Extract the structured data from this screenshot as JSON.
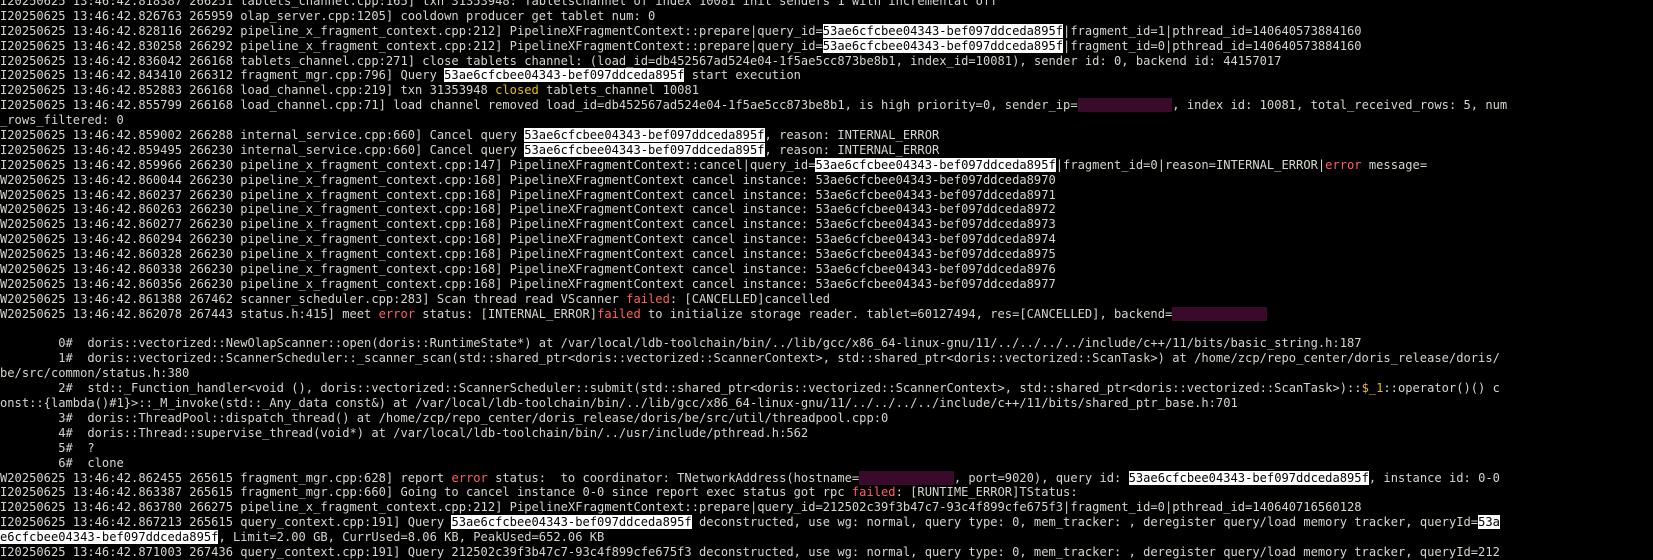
{
  "terminal": {
    "lines": [
      [
        {
          "t": "I20250625 13:46:42.818387 266251 tablets_channel.cpp:165] txn 31353948: TabletsChannel of index 10081 init senders 1 with incremental off"
        }
      ],
      [
        {
          "t": "I20250625 13:46:42.826763 265959 olap_server.cpp:1205] cooldown producer get tablet num: 0"
        }
      ],
      [
        {
          "t": "I20250625 13:46:42.828116 266292 pipeline_x_fragment_context.cpp:212] PipelineXFragmentContext::prepare|query_id="
        },
        {
          "t": "53ae6cfcbee04343-bef097ddceda895f",
          "c": "hl"
        },
        {
          "t": "|fragment_id=1|pthread_id=140640573884160"
        }
      ],
      [
        {
          "t": "I20250625 13:46:42.830258 266292 pipeline_x_fragment_context.cpp:212] PipelineXFragmentContext::prepare|query_id="
        },
        {
          "t": "53ae6cfcbee04343-bef097ddceda895f",
          "c": "hl"
        },
        {
          "t": "|fragment_id=0|pthread_id=140640573884160"
        }
      ],
      [
        {
          "t": "I20250625 13:46:42.836042 266168 tablets_channel.cpp:271] close tablets channel: (load_id=db452567ad524e04-1f5ae5cc873be8b1, index_id=10081), sender id: 0, backend id: 44157017"
        }
      ],
      [
        {
          "t": "I20250625 13:46:42.843410 266312 fragment_mgr.cpp:796] Query "
        },
        {
          "t": "53ae6cfcbee04343-bef097ddceda895f",
          "c": "hl"
        },
        {
          "t": " start execution"
        }
      ],
      [
        {
          "t": "I20250625 13:46:42.852883 266168 load_channel.cpp:219] txn 31353948 "
        },
        {
          "t": "closed",
          "c": "kwy"
        },
        {
          "t": " tablets_channel 10081"
        }
      ],
      [
        {
          "t": "I20250625 13:46:42.855799 266168 load_channel.cpp:71] load channel removed load_id=db452567ad524e04-1f5ae5cc873be8b1, is high priority=0, sender_ip="
        },
        {
          "t": "             ",
          "c": "red"
        },
        {
          "t": ", index id: 10081, total_received_rows: 5, num"
        }
      ],
      [
        {
          "t": "_rows_filtered: 0"
        }
      ],
      [
        {
          "t": "I20250625 13:46:42.859002 266288 internal_service.cpp:660] Cancel query "
        },
        {
          "t": "53ae6cfcbee04343-bef097ddceda895f",
          "c": "hl"
        },
        {
          "t": ", reason: INTERNAL_ERROR"
        }
      ],
      [
        {
          "t": "I20250625 13:46:42.859495 266230 internal_service.cpp:660] Cancel query "
        },
        {
          "t": "53ae6cfcbee04343-bef097ddceda895f",
          "c": "hl"
        },
        {
          "t": ", reason: INTERNAL_ERROR"
        }
      ],
      [
        {
          "t": "I20250625 13:46:42.859966 266230 pipeline_x_fragment_context.cpp:147] PipelineXFragmentContext::cancel|query_id="
        },
        {
          "t": "53ae6cfcbee04343-bef097ddceda895f",
          "c": "hl"
        },
        {
          "t": "|fragment_id=0|reason=INTERNAL_ERROR|"
        },
        {
          "t": "error",
          "c": "kw"
        },
        {
          "t": " message="
        }
      ],
      [
        {
          "t": "W20250625 13:46:42.860044 266230 pipeline_x_fragment_context.cpp:168] PipelineXFragmentContext cancel instance: 53ae6cfcbee04343-bef097ddceda8970"
        }
      ],
      [
        {
          "t": "W20250625 13:46:42.860237 266230 pipeline_x_fragment_context.cpp:168] PipelineXFragmentContext cancel instance: 53ae6cfcbee04343-bef097ddceda8971"
        }
      ],
      [
        {
          "t": "W20250625 13:46:42.860263 266230 pipeline_x_fragment_context.cpp:168] PipelineXFragmentContext cancel instance: 53ae6cfcbee04343-bef097ddceda8972"
        }
      ],
      [
        {
          "t": "W20250625 13:46:42.860277 266230 pipeline_x_fragment_context.cpp:168] PipelineXFragmentContext cancel instance: 53ae6cfcbee04343-bef097ddceda8973"
        }
      ],
      [
        {
          "t": "W20250625 13:46:42.860294 266230 pipeline_x_fragment_context.cpp:168] PipelineXFragmentContext cancel instance: 53ae6cfcbee04343-bef097ddceda8974"
        }
      ],
      [
        {
          "t": "W20250625 13:46:42.860328 266230 pipeline_x_fragment_context.cpp:168] PipelineXFragmentContext cancel instance: 53ae6cfcbee04343-bef097ddceda8975"
        }
      ],
      [
        {
          "t": "W20250625 13:46:42.860338 266230 pipeline_x_fragment_context.cpp:168] PipelineXFragmentContext cancel instance: 53ae6cfcbee04343-bef097ddceda8976"
        }
      ],
      [
        {
          "t": "W20250625 13:46:42.860356 266230 pipeline_x_fragment_context.cpp:168] PipelineXFragmentContext cancel instance: 53ae6cfcbee04343-bef097ddceda8977"
        }
      ],
      [
        {
          "t": "W20250625 13:46:42.861388 267462 scanner_scheduler.cpp:283] Scan thread read VScanner "
        },
        {
          "t": "failed",
          "c": "kw"
        },
        {
          "t": ": [CANCELLED]cancelled"
        }
      ],
      [
        {
          "t": "W20250625 13:46:42.862078 267443 status.h:415] meet "
        },
        {
          "t": "error",
          "c": "kw"
        },
        {
          "t": " status: [INTERNAL_ERROR]"
        },
        {
          "t": "failed",
          "c": "kw"
        },
        {
          "t": " to initialize storage reader. tablet=60127494, res=[CANCELLED], backend="
        },
        {
          "t": "             ",
          "c": "red"
        }
      ],
      [
        {
          "t": ""
        }
      ],
      [
        {
          "t": "        0#  doris::vectorized::NewOlapScanner::open(doris::RuntimeState*) at /var/local/ldb-toolchain/bin/../lib/gcc/x86_64-linux-gnu/11/../../../../include/c++/11/bits/basic_string.h:187"
        }
      ],
      [
        {
          "t": "        1#  doris::vectorized::ScannerScheduler::_scanner_scan(std::shared_ptr<doris::vectorized::ScannerContext>, std::shared_ptr<doris::vectorized::ScanTask>) at /home/zcp/repo_center/doris_release/doris/"
        }
      ],
      [
        {
          "t": "be/src/common/status.h:380"
        }
      ],
      [
        {
          "t": "        2#  std::_Function_handler<void (), doris::vectorized::ScannerScheduler::submit(std::shared_ptr<doris::vectorized::ScannerContext>, std::shared_ptr<doris::vectorized::ScanTask>)::"
        },
        {
          "t": "$_1",
          "c": "kwy"
        },
        {
          "t": "::operator()() c"
        }
      ],
      [
        {
          "t": "onst::{lambda()#1}>::_M_invoke(std::_Any_data const&) at /var/local/ldb-toolchain/bin/../lib/gcc/x86_64-linux-gnu/11/../../../../include/c++/11/bits/shared_ptr_base.h:701"
        }
      ],
      [
        {
          "t": "        3#  doris::ThreadPool::dispatch_thread() at /home/zcp/repo_center/doris_release/doris/be/src/util/threadpool.cpp:0"
        }
      ],
      [
        {
          "t": "        4#  doris::Thread::supervise_thread(void*) at /var/local/ldb-toolchain/bin/../usr/include/pthread.h:562"
        }
      ],
      [
        {
          "t": "        5#  ?"
        }
      ],
      [
        {
          "t": "        6#  clone"
        }
      ],
      [
        {
          "t": "W20250625 13:46:42.862455 265615 fragment_mgr.cpp:628] report "
        },
        {
          "t": "error",
          "c": "kw"
        },
        {
          "t": " status:  to coordinator: TNetworkAddress(hostname="
        },
        {
          "t": "             ",
          "c": "red"
        },
        {
          "t": ", port=9020), query id: "
        },
        {
          "t": "53ae6cfcbee04343-bef097ddceda895f",
          "c": "hl"
        },
        {
          "t": ", instance id: 0-0"
        }
      ],
      [
        {
          "t": "I20250625 13:46:42.863387 265615 fragment_mgr.cpp:660] Going to cancel instance 0-0 since report exec status got rpc "
        },
        {
          "t": "failed",
          "c": "kw"
        },
        {
          "t": ": [RUNTIME_ERROR]TStatus:"
        }
      ],
      [
        {
          "t": "I20250625 13:46:42.863780 266275 pipeline_x_fragment_context.cpp:212] PipelineXFragmentContext::prepare|query_id=212502c39f3b47c7-93c4f899cfe675f3|fragment_id=0|pthread_id=140640716560128"
        }
      ],
      [
        {
          "t": "I20250625 13:46:42.867213 265615 query_context.cpp:191] Query "
        },
        {
          "t": "53ae6cfcbee04343-bef097ddceda895f",
          "c": "hl"
        },
        {
          "t": " deconstructed, use wg: normal, query type: 0, mem_tracker: , deregister query/load memory tracker, queryId="
        },
        {
          "t": "53a",
          "c": "hl"
        }
      ],
      [
        {
          "t": "e6cfcbee04343-bef097ddceda895f",
          "c": "hl"
        },
        {
          "t": ", Limit=2.00 GB, CurrUsed=8.06 KB, PeakUsed=652.06 KB"
        }
      ],
      [
        {
          "t": "I20250625 13:46:42.871003 267436 query_context.cpp:191] Query 212502c39f3b47c7-93c4f899cfe675f3 deconstructed, use wg: normal, query type: 0, mem_tracker: , deregister query/load memory tracker, queryId=212"
        }
      ]
    ]
  }
}
